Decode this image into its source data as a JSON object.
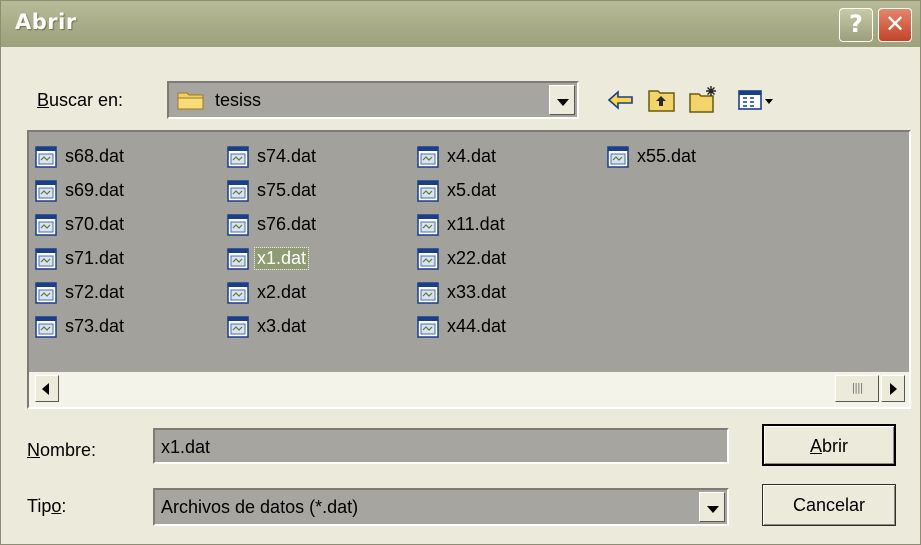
{
  "window": {
    "title": "Abrir"
  },
  "titlebar": {
    "help_glyph": "?",
    "close_glyph": "✕"
  },
  "lookin": {
    "label_prefix": "",
    "label_access": "B",
    "label_rest": "uscar en:",
    "value": "tesiss"
  },
  "toolbar": {
    "icons": [
      "back-arrow-icon",
      "up-folder-icon",
      "new-folder-icon",
      "view-menu-icon"
    ]
  },
  "files": [
    "s68.dat",
    "s69.dat",
    "s70.dat",
    "s71.dat",
    "s72.dat",
    "s73.dat",
    "s74.dat",
    "s75.dat",
    "s76.dat",
    "x1.dat",
    "x2.dat",
    "x3.dat",
    "x4.dat",
    "x5.dat",
    "x11.dat",
    "x22.dat",
    "x33.dat",
    "x44.dat",
    "x55.dat"
  ],
  "selected_file": "x1.dat",
  "filename": {
    "label_access": "N",
    "label_rest": "ombre:",
    "value": "x1.dat"
  },
  "filetype": {
    "label_prefix": "Tip",
    "label_access": "o",
    "label_rest": ":",
    "value": "Archivos de datos (*.dat)"
  },
  "buttons": {
    "open_access": "A",
    "open_rest": "brir",
    "cancel": "Cancelar"
  },
  "colors": {
    "titlebar": "#a8ac86",
    "dialog_bg": "#eceadb",
    "list_bg": "#a3a19b",
    "selection": "#8e9b73",
    "close_button": "#c4432a"
  }
}
